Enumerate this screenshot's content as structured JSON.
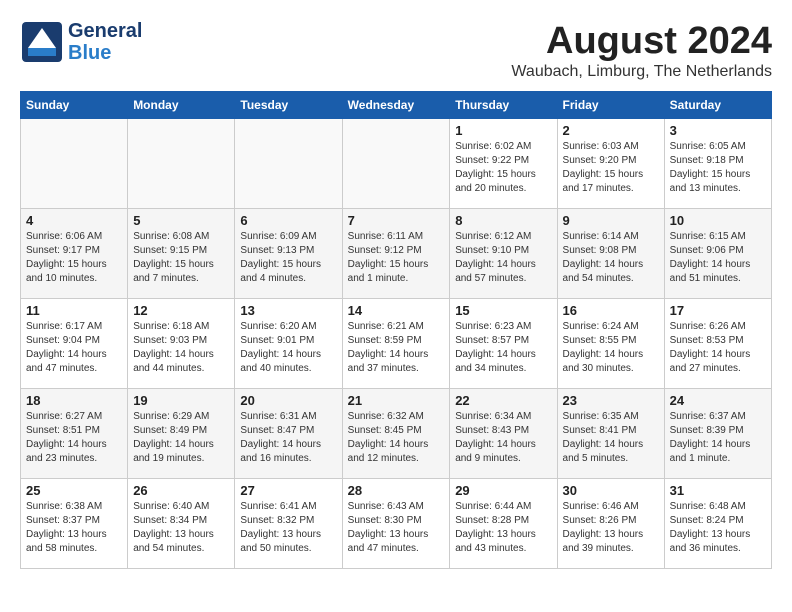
{
  "header": {
    "logo_general": "General",
    "logo_blue": "Blue",
    "month_year": "August 2024",
    "location": "Waubach, Limburg, The Netherlands"
  },
  "days_of_week": [
    "Sunday",
    "Monday",
    "Tuesday",
    "Wednesday",
    "Thursday",
    "Friday",
    "Saturday"
  ],
  "weeks": [
    [
      {
        "day": "",
        "info": ""
      },
      {
        "day": "",
        "info": ""
      },
      {
        "day": "",
        "info": ""
      },
      {
        "day": "",
        "info": ""
      },
      {
        "day": "1",
        "info": "Sunrise: 6:02 AM\nSunset: 9:22 PM\nDaylight: 15 hours\nand 20 minutes."
      },
      {
        "day": "2",
        "info": "Sunrise: 6:03 AM\nSunset: 9:20 PM\nDaylight: 15 hours\nand 17 minutes."
      },
      {
        "day": "3",
        "info": "Sunrise: 6:05 AM\nSunset: 9:18 PM\nDaylight: 15 hours\nand 13 minutes."
      }
    ],
    [
      {
        "day": "4",
        "info": "Sunrise: 6:06 AM\nSunset: 9:17 PM\nDaylight: 15 hours\nand 10 minutes."
      },
      {
        "day": "5",
        "info": "Sunrise: 6:08 AM\nSunset: 9:15 PM\nDaylight: 15 hours\nand 7 minutes."
      },
      {
        "day": "6",
        "info": "Sunrise: 6:09 AM\nSunset: 9:13 PM\nDaylight: 15 hours\nand 4 minutes."
      },
      {
        "day": "7",
        "info": "Sunrise: 6:11 AM\nSunset: 9:12 PM\nDaylight: 15 hours\nand 1 minute."
      },
      {
        "day": "8",
        "info": "Sunrise: 6:12 AM\nSunset: 9:10 PM\nDaylight: 14 hours\nand 57 minutes."
      },
      {
        "day": "9",
        "info": "Sunrise: 6:14 AM\nSunset: 9:08 PM\nDaylight: 14 hours\nand 54 minutes."
      },
      {
        "day": "10",
        "info": "Sunrise: 6:15 AM\nSunset: 9:06 PM\nDaylight: 14 hours\nand 51 minutes."
      }
    ],
    [
      {
        "day": "11",
        "info": "Sunrise: 6:17 AM\nSunset: 9:04 PM\nDaylight: 14 hours\nand 47 minutes."
      },
      {
        "day": "12",
        "info": "Sunrise: 6:18 AM\nSunset: 9:03 PM\nDaylight: 14 hours\nand 44 minutes."
      },
      {
        "day": "13",
        "info": "Sunrise: 6:20 AM\nSunset: 9:01 PM\nDaylight: 14 hours\nand 40 minutes."
      },
      {
        "day": "14",
        "info": "Sunrise: 6:21 AM\nSunset: 8:59 PM\nDaylight: 14 hours\nand 37 minutes."
      },
      {
        "day": "15",
        "info": "Sunrise: 6:23 AM\nSunset: 8:57 PM\nDaylight: 14 hours\nand 34 minutes."
      },
      {
        "day": "16",
        "info": "Sunrise: 6:24 AM\nSunset: 8:55 PM\nDaylight: 14 hours\nand 30 minutes."
      },
      {
        "day": "17",
        "info": "Sunrise: 6:26 AM\nSunset: 8:53 PM\nDaylight: 14 hours\nand 27 minutes."
      }
    ],
    [
      {
        "day": "18",
        "info": "Sunrise: 6:27 AM\nSunset: 8:51 PM\nDaylight: 14 hours\nand 23 minutes."
      },
      {
        "day": "19",
        "info": "Sunrise: 6:29 AM\nSunset: 8:49 PM\nDaylight: 14 hours\nand 19 minutes."
      },
      {
        "day": "20",
        "info": "Sunrise: 6:31 AM\nSunset: 8:47 PM\nDaylight: 14 hours\nand 16 minutes."
      },
      {
        "day": "21",
        "info": "Sunrise: 6:32 AM\nSunset: 8:45 PM\nDaylight: 14 hours\nand 12 minutes."
      },
      {
        "day": "22",
        "info": "Sunrise: 6:34 AM\nSunset: 8:43 PM\nDaylight: 14 hours\nand 9 minutes."
      },
      {
        "day": "23",
        "info": "Sunrise: 6:35 AM\nSunset: 8:41 PM\nDaylight: 14 hours\nand 5 minutes."
      },
      {
        "day": "24",
        "info": "Sunrise: 6:37 AM\nSunset: 8:39 PM\nDaylight: 14 hours\nand 1 minute."
      }
    ],
    [
      {
        "day": "25",
        "info": "Sunrise: 6:38 AM\nSunset: 8:37 PM\nDaylight: 13 hours\nand 58 minutes."
      },
      {
        "day": "26",
        "info": "Sunrise: 6:40 AM\nSunset: 8:34 PM\nDaylight: 13 hours\nand 54 minutes."
      },
      {
        "day": "27",
        "info": "Sunrise: 6:41 AM\nSunset: 8:32 PM\nDaylight: 13 hours\nand 50 minutes."
      },
      {
        "day": "28",
        "info": "Sunrise: 6:43 AM\nSunset: 8:30 PM\nDaylight: 13 hours\nand 47 minutes."
      },
      {
        "day": "29",
        "info": "Sunrise: 6:44 AM\nSunset: 8:28 PM\nDaylight: 13 hours\nand 43 minutes."
      },
      {
        "day": "30",
        "info": "Sunrise: 6:46 AM\nSunset: 8:26 PM\nDaylight: 13 hours\nand 39 minutes."
      },
      {
        "day": "31",
        "info": "Sunrise: 6:48 AM\nSunset: 8:24 PM\nDaylight: 13 hours\nand 36 minutes."
      }
    ]
  ]
}
